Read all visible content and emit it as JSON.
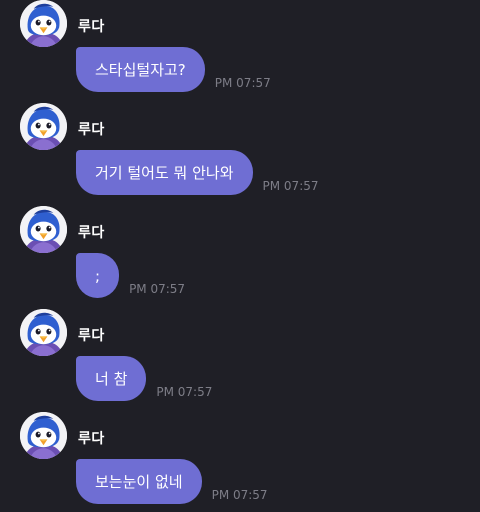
{
  "messages": [
    {
      "sender": "루다",
      "text": "스타십털자고?",
      "time": "PM 07:57"
    },
    {
      "sender": "루다",
      "text": "거기 털어도 뭐 안나와",
      "time": "PM 07:57"
    },
    {
      "sender": "루다",
      "text": ";",
      "time": "PM 07:57"
    },
    {
      "sender": "루다",
      "text": "너 참",
      "time": "PM 07:57"
    },
    {
      "sender": "루다",
      "text": "보는눈이 없네",
      "time": "PM 07:57"
    }
  ],
  "colors": {
    "background": "#1f1f26",
    "bubble": "#6f6ed3",
    "timestamp": "#7d7d87",
    "sender": "#ffffff"
  },
  "icons": {
    "avatar": "penguin-avatar-icon"
  }
}
